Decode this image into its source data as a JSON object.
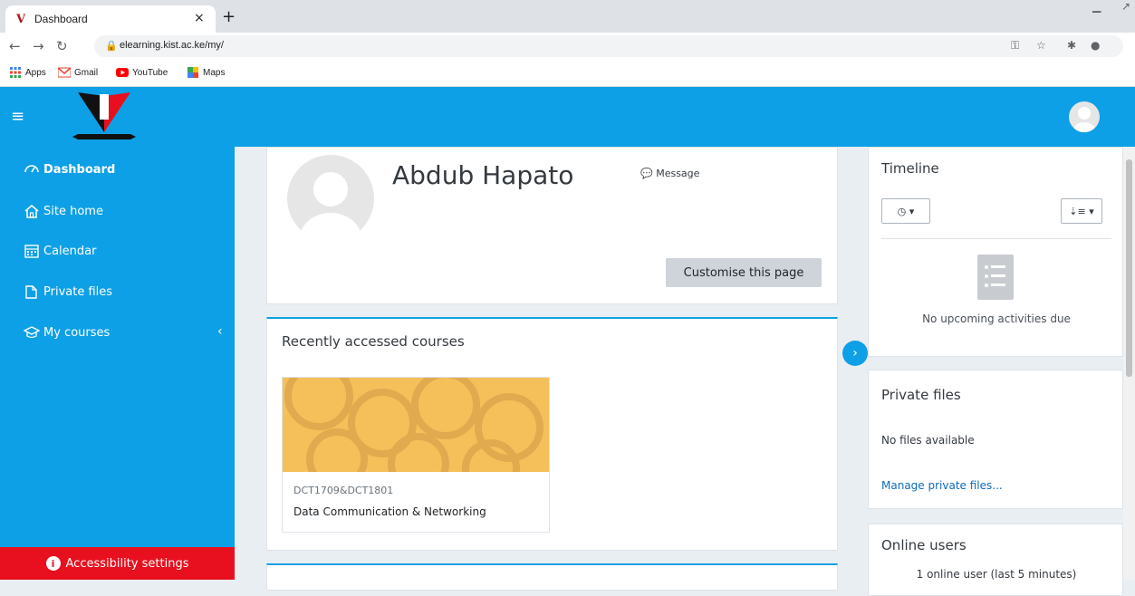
{
  "browser": {
    "tab_title": "Dashboard",
    "tab_close": "×",
    "new_tab": "+",
    "url": "elearning.kist.ac.ke/my/",
    "bookmarks": [
      "Apps",
      "Gmail",
      "YouTube",
      "Maps"
    ]
  },
  "drawer": {
    "items": [
      {
        "label": "Dashboard",
        "icon": "dashboard-icon"
      },
      {
        "label": "Site home",
        "icon": "home-icon"
      },
      {
        "label": "Calendar",
        "icon": "calendar-icon"
      },
      {
        "label": "Private files",
        "icon": "file-icon"
      },
      {
        "label": "My courses",
        "icon": "graduation-cap-icon"
      }
    ],
    "accessibility_label": "Accessibility settings"
  },
  "profile": {
    "name": "Abdub Hapato",
    "message_label": "Message",
    "customise_button": "Customise this page"
  },
  "recent": {
    "title": "Recently accessed courses",
    "course": {
      "code": "DCT1709&DCT1801",
      "name": "Data Communication & Networking"
    }
  },
  "timeline": {
    "title": "Timeline",
    "empty_text": "No upcoming activities due"
  },
  "private_files": {
    "title": "Private files",
    "empty_text": "No files available",
    "manage_link": "Manage private files..."
  },
  "online_users": {
    "title": "Online users",
    "count_text": "1 online user (last 5 minutes)"
  },
  "colors": {
    "brand": "#0ea0e6",
    "accessibility": "#e8101f",
    "course_image": "#f5c05a"
  }
}
